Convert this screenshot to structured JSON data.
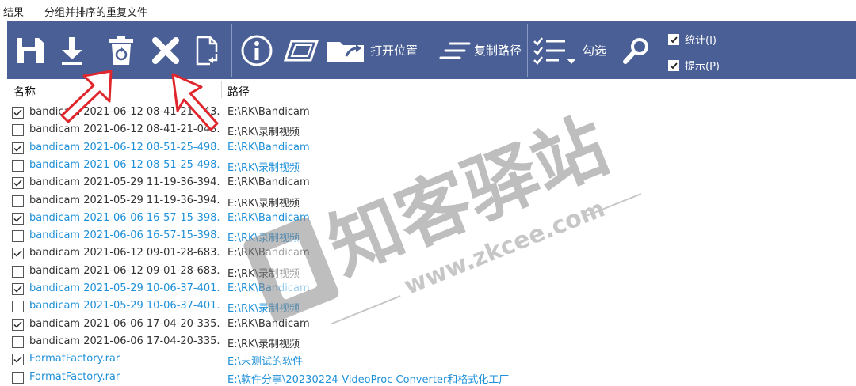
{
  "window": {
    "title": "结果——分组并排序的重复文件"
  },
  "toolbar": {
    "open_location_label": "打开位置",
    "copy_path_label": "复制路径",
    "check_label": "勾选",
    "stats_label": "统计(I)",
    "tips_label": "提示(P)"
  },
  "icons": {
    "save": "save-icon",
    "download": "download-icon",
    "recycle": "recycle-bin-icon",
    "delete": "delete-x-icon",
    "move": "move-file-icon",
    "info": "info-icon",
    "rename": "rename-icon",
    "open_location": "open-location-icon",
    "copy_path": "copy-path-icon",
    "check": "checklist-icon",
    "search": "search-icon"
  },
  "list": {
    "columns": [
      "名称",
      "路径"
    ],
    "rows": [
      {
        "name": "bandicam 2021-06-12 08-41-21-043....",
        "path": "E:\\RK\\Bandicam",
        "checked": true,
        "hl": false
      },
      {
        "name": "bandicam 2021-06-12 08-41-21-043....",
        "path": "E:\\RK\\录制视频",
        "checked": false,
        "hl": false
      },
      {
        "name": "bandicam 2021-06-12 08-51-25-498....",
        "path": "E:\\RK\\Bandicam",
        "checked": true,
        "hl": true
      },
      {
        "name": "bandicam 2021-06-12 08-51-25-498....",
        "path": "E:\\RK\\录制视频",
        "checked": false,
        "hl": true
      },
      {
        "name": "bandicam 2021-05-29 11-19-36-394....",
        "path": "E:\\RK\\Bandicam",
        "checked": true,
        "hl": false
      },
      {
        "name": "bandicam 2021-05-29 11-19-36-394....",
        "path": "E:\\RK\\录制视频",
        "checked": false,
        "hl": false
      },
      {
        "name": "bandicam 2021-06-06 16-57-15-398....",
        "path": "E:\\RK\\Bandicam",
        "checked": true,
        "hl": true
      },
      {
        "name": "bandicam 2021-06-06 16-57-15-398....",
        "path": "E:\\RK\\录制视频",
        "checked": false,
        "hl": true
      },
      {
        "name": "bandicam 2021-06-12 09-01-28-683....",
        "path": "E:\\RK\\Bandicam",
        "checked": true,
        "hl": false
      },
      {
        "name": "bandicam 2021-06-12 09-01-28-683....",
        "path": "E:\\RK\\录制视频",
        "checked": false,
        "hl": false
      },
      {
        "name": "bandicam 2021-05-29 10-06-37-401....",
        "path": "E:\\RK\\Bandicam",
        "checked": true,
        "hl": true
      },
      {
        "name": "bandicam 2021-05-29 10-06-37-401....",
        "path": "E:\\RK\\录制视频",
        "checked": false,
        "hl": true
      },
      {
        "name": "bandicam 2021-06-06 17-04-20-335....",
        "path": "E:\\RK\\Bandicam",
        "checked": true,
        "hl": false
      },
      {
        "name": "bandicam 2021-06-06 17-04-20-335....",
        "path": "E:\\RK\\录制视频",
        "checked": false,
        "hl": false
      },
      {
        "name": "FormatFactory.rar",
        "path": "E:\\未测试的软件",
        "checked": true,
        "hl": true
      },
      {
        "name": "FormatFactory.rar",
        "path": "E:\\软件分享\\20230224-VideoProc Converter和格式化工厂",
        "checked": false,
        "hl": true
      }
    ]
  },
  "watermark": {
    "logo_text": "知客驿站",
    "url": "www.zkcee.com"
  },
  "colors": {
    "toolbar": "#4a5f95",
    "highlight": "#1e90d8",
    "arrow": "#e0262d"
  }
}
